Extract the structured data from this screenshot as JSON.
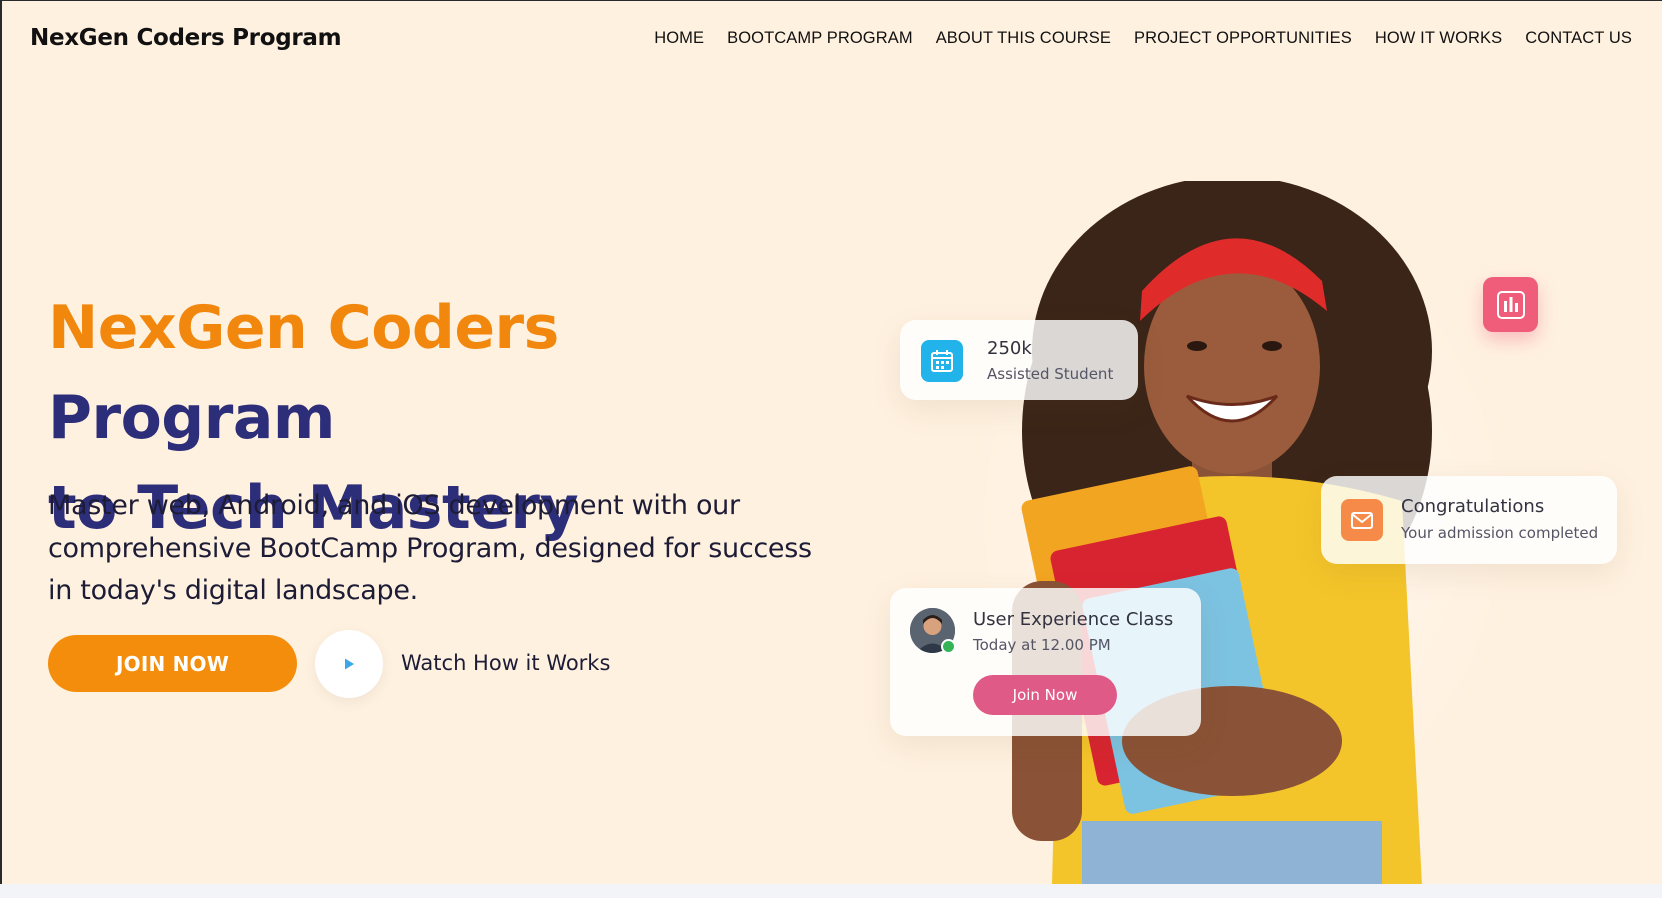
{
  "header": {
    "brand": "NexGen Coders Program",
    "nav": [
      "HOME",
      "BOOTCAMP PROGRAM",
      "ABOUT THIS COURSE",
      "PROJECT OPPORTUNITIES",
      "HOW IT WORKS",
      "CONTACT US"
    ]
  },
  "hero": {
    "title_accent": "NexGen Coders",
    "title_rest_line1": "Program",
    "title_line2": "to Tech Mastery",
    "description": "Master web, Android, and iOS development with our comprehensive BootCamp Program, designed for success in today's digital landscape.",
    "join_label": "JOIN NOW",
    "watch_label": "Watch How it Works"
  },
  "cards": {
    "stat": {
      "value": "250k",
      "label": "Assisted Student",
      "icon": "calendar-icon"
    },
    "congrats": {
      "title": "Congratulations",
      "subtitle": "Your admission completed",
      "icon": "mail-icon"
    },
    "class": {
      "title": "User Experience Class",
      "time": "Today at 12.00 PM",
      "button": "Join Now"
    }
  },
  "colors": {
    "background": "#fff1e0",
    "accent_orange": "#f2870d",
    "title_navy": "#2d2e7a",
    "pink": "#e05a88",
    "calendar_blue": "#22b3ea",
    "mail_orange": "#f58a49",
    "chart_pink": "#ef5d7a"
  }
}
